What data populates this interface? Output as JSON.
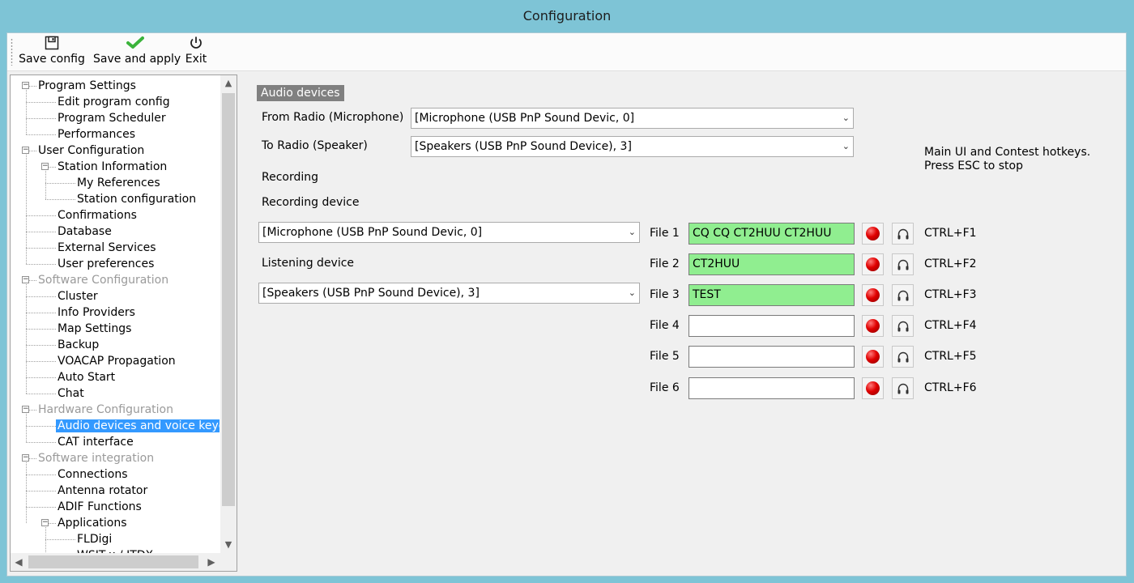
{
  "window": {
    "title": "Configuration"
  },
  "toolbar": {
    "save_config": "Save config",
    "save_apply": "Save and apply",
    "exit": "Exit"
  },
  "tree": {
    "items": [
      {
        "label": "Program Settings",
        "level": 0,
        "expander": "minus",
        "gray": false
      },
      {
        "label": "Edit program config",
        "level": 1
      },
      {
        "label": "Program Scheduler",
        "level": 1
      },
      {
        "label": "Performances",
        "level": 1
      },
      {
        "label": "User Configuration",
        "level": 0,
        "expander": "minus"
      },
      {
        "label": "Station Information",
        "level": 1,
        "expander": "minus"
      },
      {
        "label": "My References",
        "level": 2
      },
      {
        "label": "Station configuration",
        "level": 2
      },
      {
        "label": "Confirmations",
        "level": 1
      },
      {
        "label": "Database",
        "level": 1
      },
      {
        "label": "External Services",
        "level": 1
      },
      {
        "label": "User preferences",
        "level": 1
      },
      {
        "label": "Software Configuration",
        "level": 0,
        "expander": "minus",
        "gray": true
      },
      {
        "label": "Cluster",
        "level": 1
      },
      {
        "label": "Info Providers",
        "level": 1
      },
      {
        "label": "Map Settings",
        "level": 1
      },
      {
        "label": "Backup",
        "level": 1
      },
      {
        "label": "VOACAP Propagation",
        "level": 1
      },
      {
        "label": "Auto Start",
        "level": 1
      },
      {
        "label": "Chat",
        "level": 1
      },
      {
        "label": "Hardware Configuration",
        "level": 0,
        "expander": "minus",
        "gray": true
      },
      {
        "label": "Audio devices and voice keyer",
        "level": 1,
        "selected": true
      },
      {
        "label": "CAT interface",
        "level": 1
      },
      {
        "label": "Software integration",
        "level": 0,
        "expander": "minus",
        "gray": true
      },
      {
        "label": "Connections",
        "level": 1
      },
      {
        "label": "Antenna rotator",
        "level": 1
      },
      {
        "label": "ADIF Functions",
        "level": 1
      },
      {
        "label": "Applications",
        "level": 1,
        "expander": "minus"
      },
      {
        "label": "FLDigi",
        "level": 2
      },
      {
        "label": "WSJT-x / JTDX",
        "level": 2
      }
    ]
  },
  "panel": {
    "section_title": "Audio devices",
    "from_radio_label": "From Radio (Microphone)",
    "from_radio_value": "[Microphone (USB PnP Sound Devic, 0]",
    "to_radio_label": "To Radio (Speaker)",
    "to_radio_value": "[Speakers (USB PnP Sound Device), 3]",
    "hotkeys_note_line1": "Main UI and Contest hotkeys.",
    "hotkeys_note_line2": "Press ESC to stop",
    "recording_header": "Recording",
    "recording_device_label": "Recording device",
    "recording_device_value": "[Microphone (USB PnP Sound Devic, 0]",
    "listening_device_label": "Listening device",
    "listening_device_value": "[Speakers (USB PnP Sound Device), 3]",
    "files": [
      {
        "label": "File 1",
        "value": "CQ CQ CT2HUU CT2HUU",
        "hotkey": "CTRL+F1"
      },
      {
        "label": "File 2",
        "value": "CT2HUU",
        "hotkey": "CTRL+F2"
      },
      {
        "label": "File 3",
        "value": "TEST",
        "hotkey": "CTRL+F3"
      },
      {
        "label": "File 4",
        "value": "",
        "hotkey": "CTRL+F4"
      },
      {
        "label": "File 5",
        "value": "",
        "hotkey": "CTRL+F5"
      },
      {
        "label": "File 6",
        "value": "",
        "hotkey": "CTRL+F6"
      }
    ]
  },
  "colors": {
    "title_bar": "#7ec4d6",
    "filled_field": "#90ee90",
    "selection": "#3399ff",
    "record": "#e00000"
  },
  "icons": {
    "save_config": "floppy-disk-icon",
    "save_apply": "green-check-icon",
    "exit": "power-icon",
    "record": "red-dot-icon",
    "play": "headphones-icon"
  }
}
